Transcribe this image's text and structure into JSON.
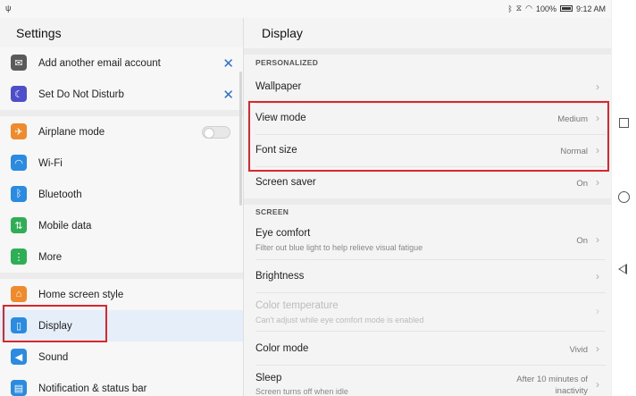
{
  "status": {
    "left_icon": "usb-icon",
    "right_icons": [
      "bluetooth-icon",
      "vibrate-icon",
      "wifi-icon"
    ],
    "battery": "100%",
    "time": "9:12 AM"
  },
  "left": {
    "title": "Settings",
    "items": [
      {
        "label": "Add another email account",
        "icon": "mail-icon",
        "color": "#5a5a5a",
        "dismiss": "✕"
      },
      {
        "label": "Set Do Not Disturb",
        "icon": "moon-icon",
        "color": "#4c4fc9",
        "dismiss": "✕"
      },
      {
        "label": "Airplane mode",
        "icon": "airplane-icon",
        "color": "#f08b2d"
      },
      {
        "label": "Wi-Fi",
        "icon": "wifi-icon",
        "color": "#2b8be0"
      },
      {
        "label": "Bluetooth",
        "icon": "bluetooth-icon",
        "color": "#2b8be0"
      },
      {
        "label": "Mobile data",
        "icon": "mobile-data-icon",
        "color": "#2fae55"
      },
      {
        "label": "More",
        "icon": "more-icon",
        "color": "#2fae55"
      },
      {
        "label": "Home screen style",
        "icon": "home-icon",
        "color": "#f08b2d"
      },
      {
        "label": "Display",
        "icon": "display-icon",
        "color": "#2b8be0"
      },
      {
        "label": "Sound",
        "icon": "sound-icon",
        "color": "#2b8be0"
      },
      {
        "label": "Notification & status bar",
        "icon": "notification-icon",
        "color": "#2b8be0"
      }
    ]
  },
  "right": {
    "title": "Display",
    "section_personalized": "PERSONALIZED",
    "section_screen": "SCREEN",
    "wallpaper": {
      "label": "Wallpaper"
    },
    "view_mode": {
      "label": "View mode",
      "value": "Medium"
    },
    "font_size": {
      "label": "Font size",
      "value": "Normal"
    },
    "screen_saver": {
      "label": "Screen saver",
      "value": "On"
    },
    "eye_comfort": {
      "label": "Eye comfort",
      "sub": "Filter out blue light to help relieve visual fatigue",
      "value": "On"
    },
    "brightness": {
      "label": "Brightness"
    },
    "color_temperature": {
      "label": "Color temperature",
      "sub": "Can't adjust while eye comfort mode is enabled"
    },
    "color_mode": {
      "label": "Color mode",
      "value": "Vivid"
    },
    "sleep": {
      "label": "Sleep",
      "sub": "Screen turns off when idle",
      "value_line1": "After 10 minutes of",
      "value_line2": "inactivity"
    }
  },
  "accent": "#d9272e"
}
